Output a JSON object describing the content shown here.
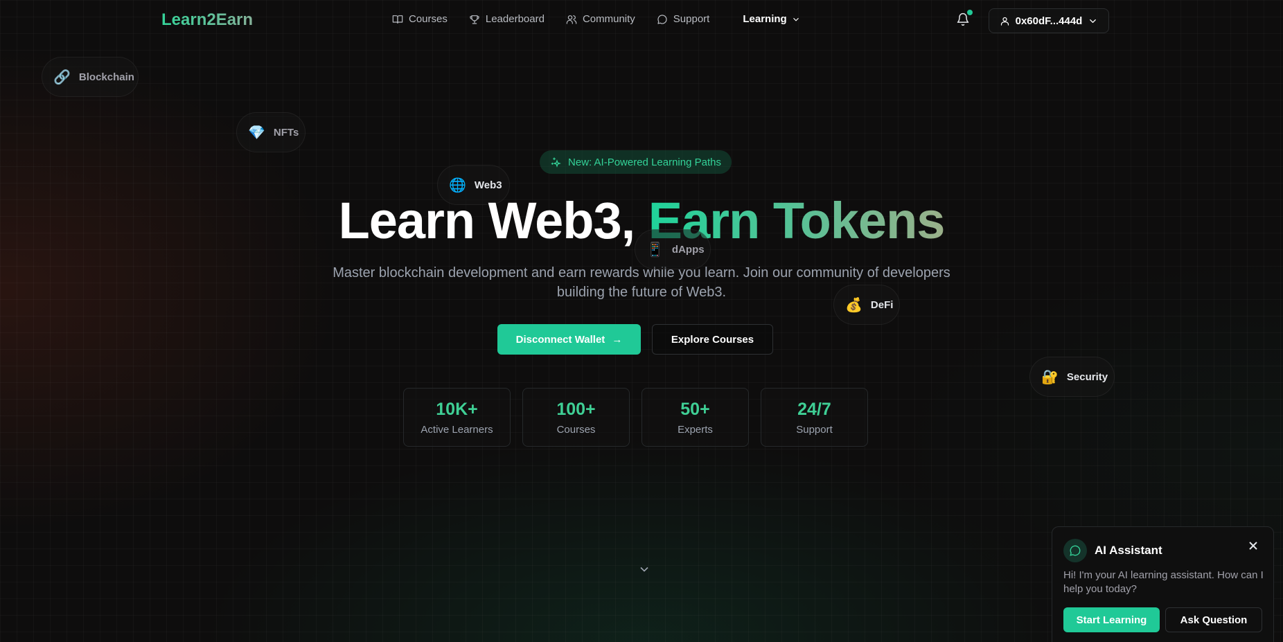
{
  "nav": {
    "logo": "Learn2Earn",
    "links": [
      {
        "label": "Courses",
        "icon": "book-icon"
      },
      {
        "label": "Leaderboard",
        "icon": "trophy-icon"
      },
      {
        "label": "Community",
        "icon": "users-icon"
      },
      {
        "label": "Support",
        "icon": "message-circle-icon"
      }
    ],
    "dropdown_label": "Learning",
    "wallet_address": "0x60dF...444d"
  },
  "floating_tags": [
    {
      "label": "Blockchain",
      "emoji": "🔗"
    },
    {
      "label": "NFTs",
      "emoji": "💎"
    },
    {
      "label": "Web3",
      "emoji": "🌐"
    },
    {
      "label": "dApps",
      "emoji": "📱"
    },
    {
      "label": "DeFi",
      "emoji": "💰"
    },
    {
      "label": "Security",
      "emoji": "🔐"
    }
  ],
  "hero": {
    "badge": "New: AI-Powered Learning Paths",
    "title_main": "Learn Web3,",
    "title_accent": "Earn Tokens",
    "subtitle": "Master blockchain development and earn rewards while you learn. Join our community of developers building the future of Web3.",
    "primary_button": "Disconnect Wallet",
    "primary_arrow": "→",
    "secondary_button": "Explore Courses"
  },
  "stats": [
    {
      "value": "10K+",
      "label": "Active Learners"
    },
    {
      "value": "100+",
      "label": "Courses"
    },
    {
      "value": "50+",
      "label": "Experts"
    },
    {
      "value": "24/7",
      "label": "Support"
    }
  ],
  "assistant": {
    "title": "AI Assistant",
    "message": "Hi! I'm your AI learning assistant. How can I help you today?",
    "start_button": "Start Learning",
    "ask_button": "Ask Question"
  },
  "colors": {
    "accent": "#20c997",
    "background": "#0e0d0d",
    "stat_value": "#3fcf95"
  }
}
